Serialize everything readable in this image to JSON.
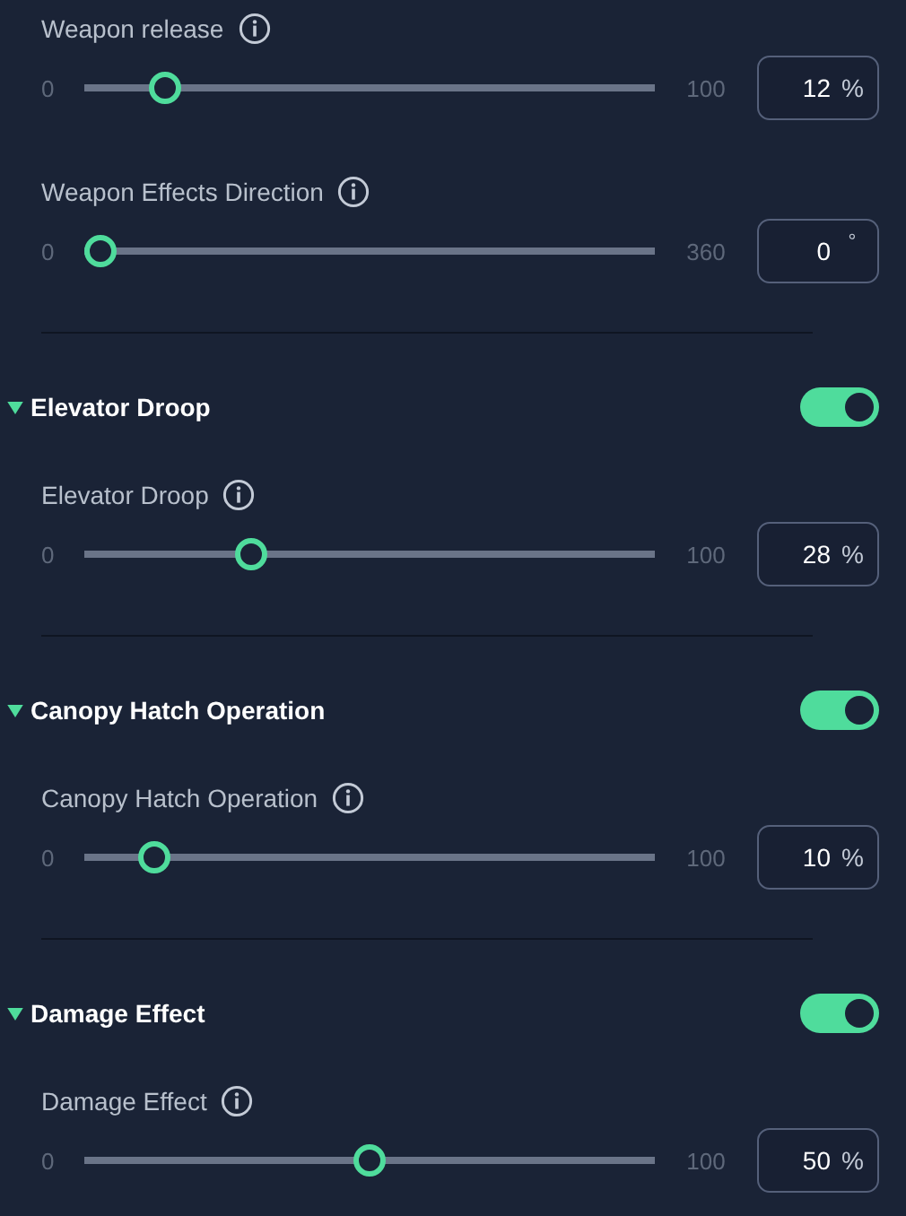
{
  "sections": [
    {
      "sliders": [
        {
          "label": "Weapon release",
          "min": "0",
          "max": "100",
          "level": 0.12,
          "value": "12",
          "unit": "%"
        },
        {
          "label": "Weapon Effects Direction",
          "min": "0",
          "max": "360",
          "level": 0,
          "value": "0",
          "unit": "°"
        }
      ]
    },
    {
      "title": "Elevator Droop",
      "expanded": true,
      "on": true,
      "sliders": [
        {
          "label": "Elevator Droop",
          "min": "0",
          "max": "100",
          "level": 0.28,
          "value": "28",
          "unit": "%"
        }
      ]
    },
    {
      "title": "Canopy Hatch Operation",
      "expanded": true,
      "on": true,
      "sliders": [
        {
          "label": "Canopy Hatch Operation",
          "min": "0",
          "max": "100",
          "level": 0.1,
          "value": "10",
          "unit": "%"
        }
      ]
    },
    {
      "title": "Damage Effect",
      "expanded": true,
      "on": true,
      "sliders": [
        {
          "label": "Damage Effect",
          "min": "0",
          "max": "100",
          "level": 0.5,
          "value": "50",
          "unit": "%"
        }
      ]
    }
  ]
}
